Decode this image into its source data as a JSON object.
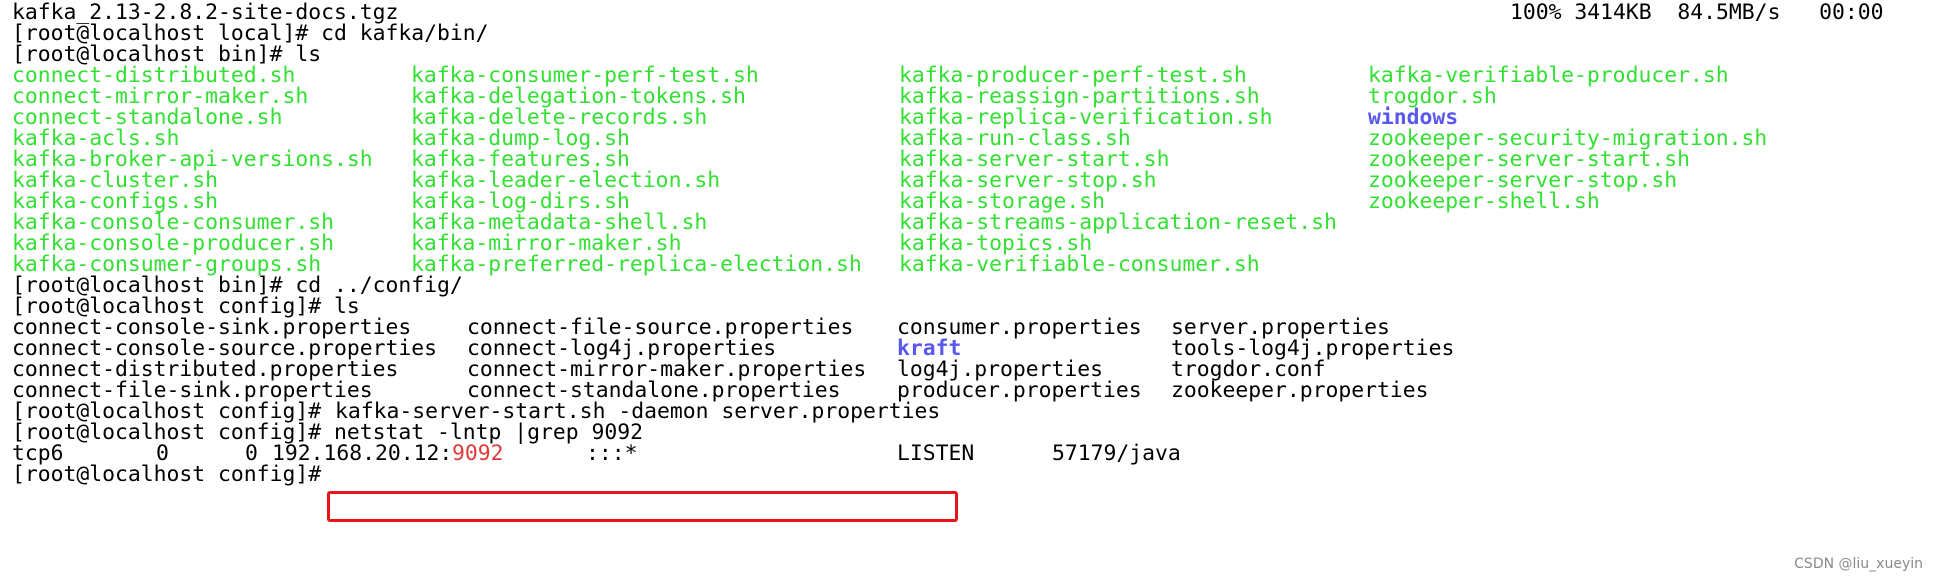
{
  "line_download": {
    "file": "kafka_2.13-2.8.2-site-docs.tgz",
    "progress": "100% 3414KB  84.5MB/s   00:00"
  },
  "commands": {
    "cd_bin": "[root@localhost local]# cd kafka/bin/",
    "ls_bin": "[root@localhost bin]# ls",
    "cd_config": "[root@localhost bin]# cd ../config/",
    "ls_config": "[root@localhost config]# ls",
    "prompt_config": "[root@localhost config]#",
    "start_cmd": "kafka-server-start.sh -daemon server.properties",
    "netstat_cmd": "[root@localhost config]# netstat -lntp |grep 9092",
    "last_prompt": "[root@localhost config]# "
  },
  "bin_files": {
    "col1": [
      "connect-distributed.sh",
      "connect-mirror-maker.sh",
      "connect-standalone.sh",
      "kafka-acls.sh",
      "kafka-broker-api-versions.sh",
      "kafka-cluster.sh",
      "kafka-configs.sh",
      "kafka-console-consumer.sh",
      "kafka-console-producer.sh",
      "kafka-consumer-groups.sh"
    ],
    "col2": [
      "kafka-consumer-perf-test.sh",
      "kafka-delegation-tokens.sh",
      "kafka-delete-records.sh",
      "kafka-dump-log.sh",
      "kafka-features.sh",
      "kafka-leader-election.sh",
      "kafka-log-dirs.sh",
      "kafka-metadata-shell.sh",
      "kafka-mirror-maker.sh",
      "kafka-preferred-replica-election.sh"
    ],
    "col3": [
      "kafka-producer-perf-test.sh",
      "kafka-reassign-partitions.sh",
      "kafka-replica-verification.sh",
      "kafka-run-class.sh",
      "kafka-server-start.sh",
      "kafka-server-stop.sh",
      "kafka-storage.sh",
      "kafka-streams-application-reset.sh",
      "kafka-topics.sh",
      "kafka-verifiable-consumer.sh"
    ],
    "col4": [
      "kafka-verifiable-producer.sh",
      "trogdor.sh",
      "windows",
      "zookeeper-security-migration.sh",
      "zookeeper-server-start.sh",
      "zookeeper-server-stop.sh",
      "zookeeper-shell.sh"
    ]
  },
  "config_files": {
    "col1": [
      "connect-console-sink.properties",
      "connect-console-source.properties",
      "connect-distributed.properties",
      "connect-file-sink.properties"
    ],
    "col2": [
      "connect-file-source.properties",
      "connect-log4j.properties",
      "connect-mirror-maker.properties",
      "connect-standalone.properties"
    ],
    "col3": [
      "consumer.properties",
      "kraft",
      "log4j.properties",
      "producer.properties"
    ],
    "col4": [
      "server.properties",
      "tools-log4j.properties",
      "trogdor.conf",
      "zookeeper.properties"
    ]
  },
  "netstat": {
    "proto": "tcp6",
    "recvq": "0",
    "sendq": "0",
    "local_ip": "192.168.20.12:",
    "local_port": "9092",
    "foreign": ":::*",
    "state": "LISTEN",
    "pid": "57179/java"
  },
  "watermark": "CSDN @liu_xueyin",
  "colors": {
    "executable": "#33e033",
    "directory": "#5858f0",
    "match_highlight": "#e03a3a",
    "annotation_box": "#e8141c"
  }
}
